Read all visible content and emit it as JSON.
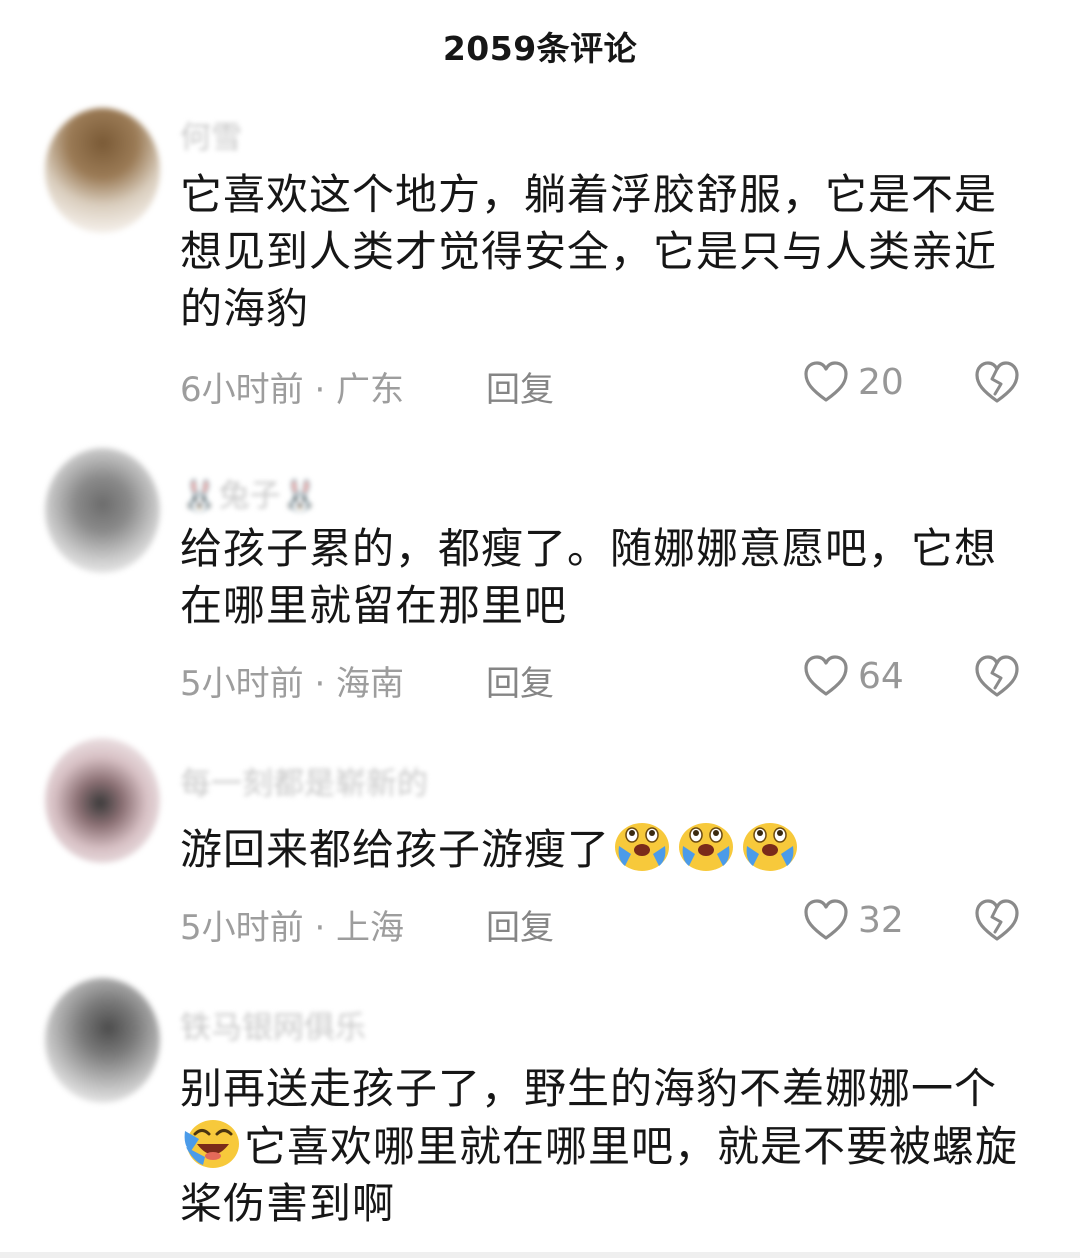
{
  "header": {
    "title": "2059条评论"
  },
  "comments": [
    {
      "username": "何雪",
      "content": "它喜欢这个地方，躺着浮胶舒服，它是不是想见到人类才觉得安全，它是只与人类亲近的海豹",
      "time": "6小时前 · 广东",
      "reply_label": "回复",
      "likes": "20"
    },
    {
      "username": "🐰兔子🐰",
      "content": "给孩子累的，都瘦了。随娜娜意愿吧，它想在哪里就留在那里吧",
      "time": "5小时前 · 海南",
      "reply_label": "回复",
      "likes": "64"
    },
    {
      "username": "每一刻都是崭新的",
      "content": "游回来都给孩子游瘦了",
      "time": "5小时前 · 上海",
      "reply_label": "回复",
      "likes": "32"
    },
    {
      "username": "铁马银网俱乐",
      "content_a": "别再送走孩子了，野生的海豹不差娜娜一个",
      "content_b": "它喜欢哪里就在哪里吧，就是不要被螺旋桨伤害到啊"
    }
  ],
  "icons": {
    "like": "heart-outline-icon",
    "dislike": "broken-heart-icon",
    "emoji_cry": "crying-face-emoji",
    "emoji_laugh_cry": "laugh-cry-emoji"
  },
  "colors": {
    "text": "#161616",
    "meta": "#9d9d9d",
    "emoji_yellow": "#f7c93b",
    "emoji_tear": "#4b9be9"
  }
}
